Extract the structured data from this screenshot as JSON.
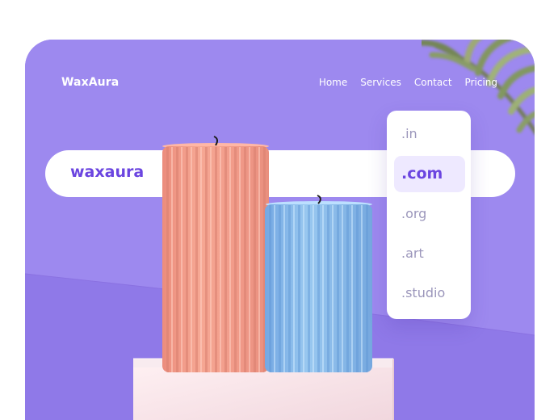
{
  "brand": {
    "name": "WaxAura"
  },
  "nav": {
    "items": [
      "Home",
      "Services",
      "Contact",
      "Pricing"
    ]
  },
  "search": {
    "value": "waxaura"
  },
  "domain_dropdown": {
    "options": [
      ".in",
      ".com",
      ".org",
      ".art",
      ".studio"
    ],
    "selected": ".com"
  },
  "colors": {
    "accent": "#6b45e0",
    "card_background": "#9c87ee",
    "floor": "#8f79e8",
    "dropdown_selected_background": "#eee9ff",
    "dropdown_text": "#9b96bb",
    "salmon_candle": "#f29b87",
    "blue_candle": "#89b9ea",
    "pedestal": "#fbe5ea"
  },
  "icons": {
    "background_plant": "palm-leaf-icon"
  }
}
